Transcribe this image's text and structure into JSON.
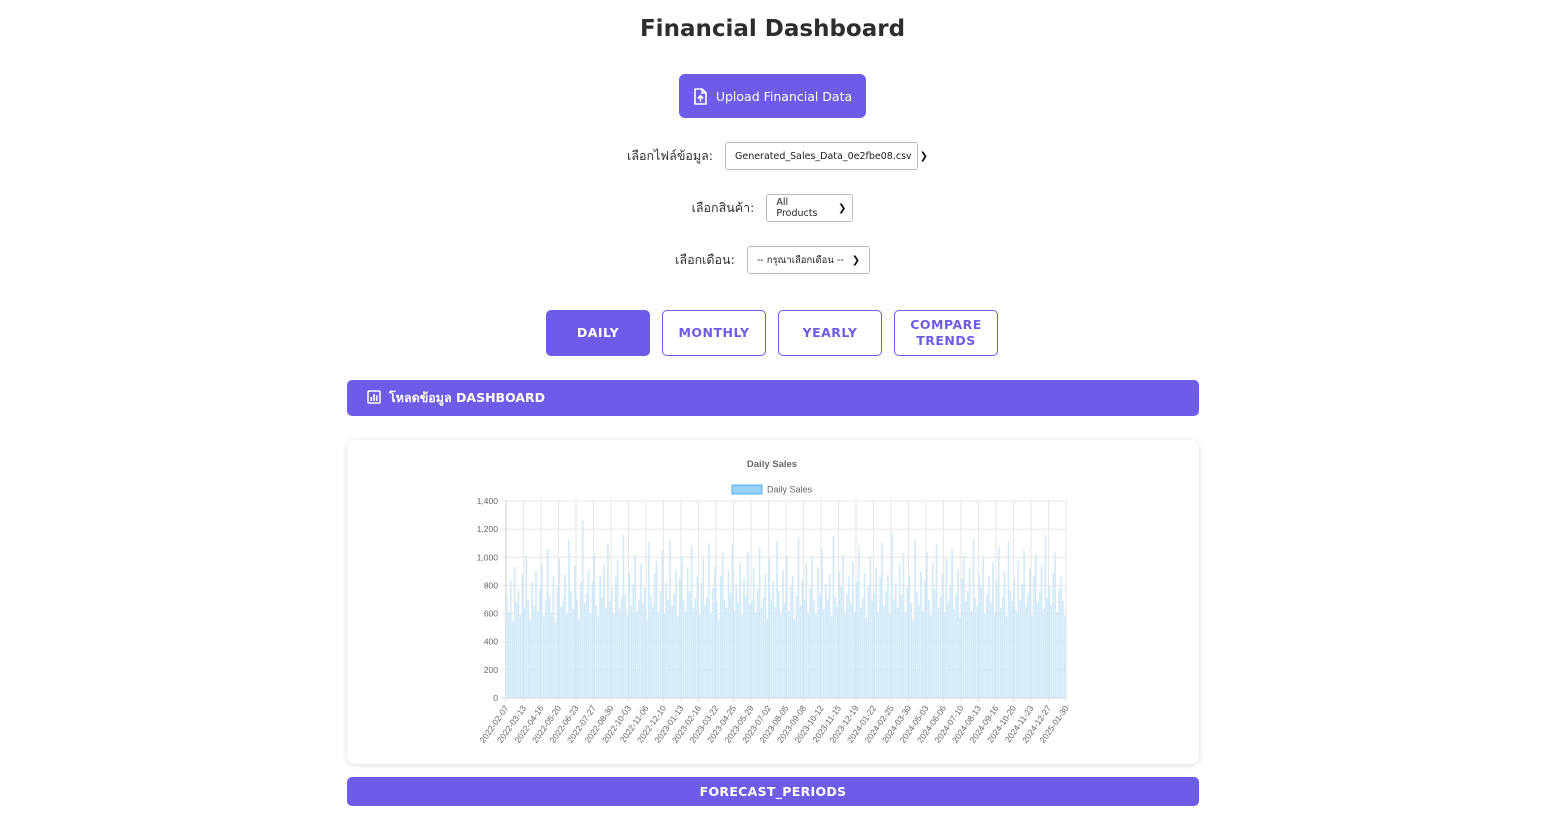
{
  "header": {
    "title": "Financial Dashboard"
  },
  "upload": {
    "label": "Upload Financial Data",
    "icon": "file-upload-icon"
  },
  "filters": {
    "file_label": "เลือกไฟล์ข้อมูล:",
    "file_value": "Generated_Sales_Data_0e2fbe08.csv",
    "product_label": "เลือกสินค้า:",
    "product_value": "All Products",
    "month_label": "เลือกเดือน:",
    "month_value": "-- กรุณาเลือกเดือน --"
  },
  "tabs": [
    {
      "label": "DAILY",
      "active": true
    },
    {
      "label": "MONTHLY",
      "active": false
    },
    {
      "label": "YEARLY",
      "active": false
    },
    {
      "label": "COMPARE TRENDS",
      "active": false
    }
  ],
  "section": {
    "label": "โหลดข้อมูล DASHBOARD",
    "icon": "bar-chart-icon"
  },
  "forecast": {
    "label": "FORECAST_PERIODS"
  },
  "colors": {
    "accent": "#6c5ce7",
    "bar_fill": "#cfe8f9",
    "legend_fill": "#9ad0f5"
  },
  "chart_data": {
    "type": "bar",
    "title": "Daily Sales",
    "legend": [
      "Daily Sales"
    ],
    "legend_position": "top",
    "grid": true,
    "ylim": [
      0,
      1400
    ],
    "yticks": [
      0,
      200,
      400,
      600,
      800,
      1000,
      1200,
      1400
    ],
    "xlim": [
      "2022-02-07",
      "2025-01-30"
    ],
    "xtick_labels": [
      "2022-02-07",
      "2022-03-13",
      "2022-04-16",
      "2022-05-20",
      "2022-06-23",
      "2022-07-27",
      "2022-08-30",
      "2022-10-03",
      "2022-11-06",
      "2022-12-10",
      "2023-01-13",
      "2023-02-16",
      "2023-03-22",
      "2023-04-25",
      "2023-05-29",
      "2023-07-02",
      "2023-08-05",
      "2023-09-08",
      "2023-10-12",
      "2023-11-15",
      "2023-12-19",
      "2024-01-22",
      "2024-02-25",
      "2024-03-30",
      "2024-05-03",
      "2024-06-06",
      "2024-07-10",
      "2024-08-13",
      "2024-09-16",
      "2024-10-20",
      "2024-11-23",
      "2024-12-27",
      "2025-01-30"
    ],
    "series": [
      {
        "name": "Daily Sales",
        "values": [
          720,
          610,
          840,
          550,
          930,
          680,
          760,
          590,
          880,
          640,
          1010,
          700,
          560,
          820,
          660,
          900,
          620,
          770,
          950,
          580,
          690,
          1060,
          730,
          610,
          860,
          540,
          790,
          990,
          650,
          710,
          880,
          600,
          1120,
          760,
          630,
          940,
          700,
          560,
          820,
          1260,
          680,
          740,
          910,
          600,
          830,
          1020,
          660,
          580,
          870,
          720,
          950,
          640,
          1100,
          690,
          780,
          600,
          860,
          980,
          630,
          710,
          1160,
          740,
          590,
          890,
          660,
          810,
          1020,
          620,
          700,
          950,
          680,
          780,
          560,
          1110,
          730,
          650,
          890,
          970,
          610,
          760,
          1050,
          600,
          820,
          700,
          1130,
          660,
          740,
          910,
          580,
          850,
          1000,
          690,
          620,
          930,
          760,
          1080,
          640,
          710,
          870,
          590,
          820,
          990,
          660,
          720,
          1100,
          600,
          780,
          940,
          680,
          560,
          870,
          1030,
          700,
          640,
          910,
          750,
          1090,
          620,
          800,
          680,
          960,
          590,
          850,
          730,
          1040,
          660,
          690,
          920,
          610,
          780,
          1070,
          640,
          720,
          880,
          570,
          990,
          700,
          830,
          650,
          1110,
          760,
          600,
          910,
          680,
          1010,
          620,
          790,
          870,
          560,
          730,
          1140,
          660,
          840,
          700,
          960,
          610,
          780,
          1000,
          690,
          590,
          930,
          740,
          1060,
          630,
          810,
          700,
          880,
          580,
          1150,
          720,
          650,
          900,
          790,
          1020,
          600,
          740,
          860,
          680,
          970,
          610,
          830,
          1080,
          640,
          710,
          890,
          570,
          800,
          1010,
          690,
          740,
          930,
          620,
          860,
          1100,
          650,
          760,
          880,
          590,
          1170,
          700,
          820,
          640,
          950,
          730,
          1030,
          610,
          790,
          870,
          680,
          560,
          1120,
          750,
          660,
          900,
          620,
          840,
          1040,
          700,
          590,
          960,
          770,
          1090,
          640,
          720,
          880,
          610,
          990,
          680,
          800,
          1060,
          630,
          740,
          910,
          570,
          850,
          1010,
          690,
          760,
          930,
          620,
          1130,
          710,
          650,
          880,
          790,
          1000,
          600,
          740,
          870,
          680,
          960,
          610,
          830,
          1070,
          640,
          720,
          900,
          580,
          1110,
          760,
          690,
          850,
          620,
          980,
          700,
          810,
          1050,
          650,
          740,
          920,
          590,
          870,
          1020,
          680,
          760,
          940,
          630,
          1160,
          710,
          800,
          660,
          890,
          1030,
          610,
          770,
          860,
          690,
          580
        ]
      }
    ]
  }
}
